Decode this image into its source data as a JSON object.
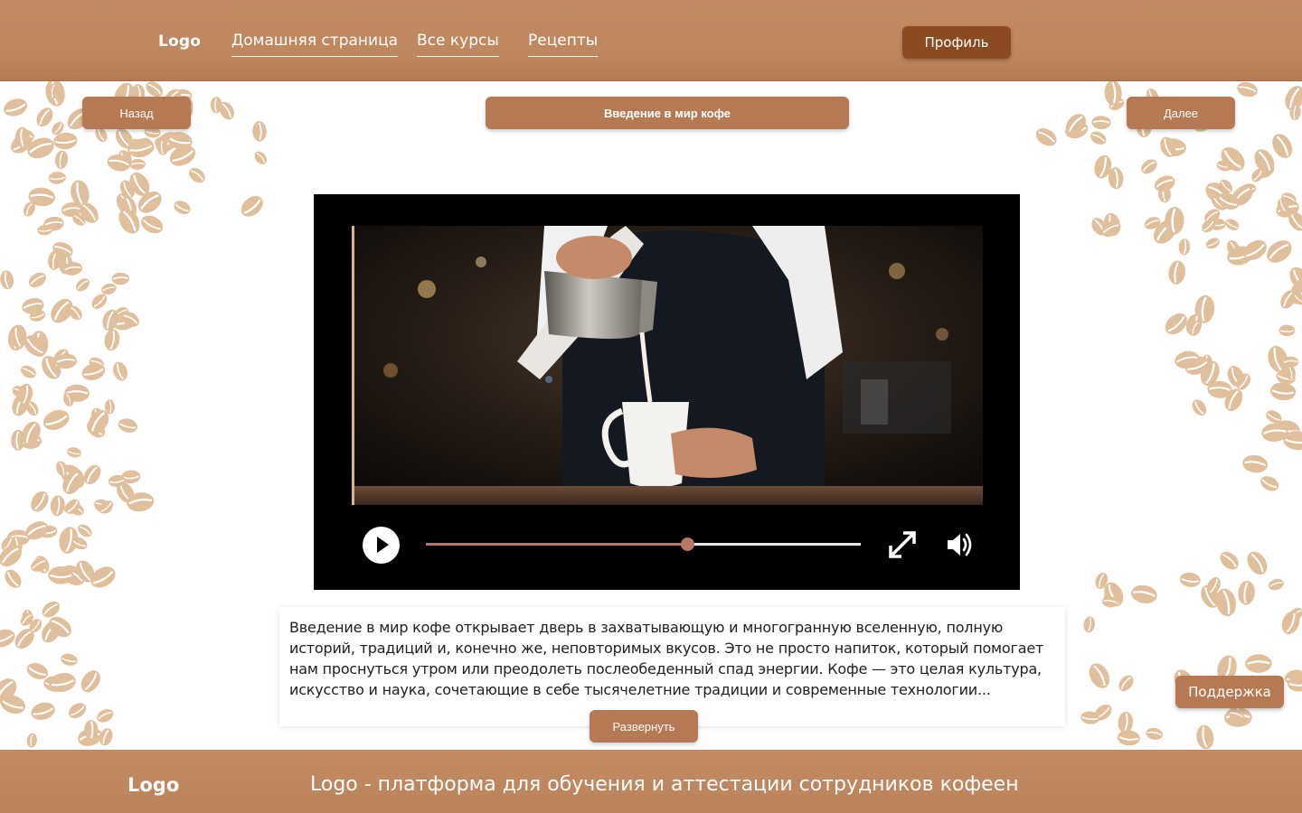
{
  "header": {
    "logo": "Logo",
    "nav": [
      {
        "label": "Домашняя страница"
      },
      {
        "label": "Все курсы"
      },
      {
        "label": "Рецепты"
      }
    ],
    "profile_label": "Профиль"
  },
  "lesson": {
    "back_label": "Назад",
    "title": "Введение в мир кофе",
    "next_label": "Далее"
  },
  "video": {
    "progress": 0.6,
    "play_icon": "play-icon",
    "fullscreen_icon": "fullscreen-icon",
    "volume_icon": "volume-icon"
  },
  "description": {
    "text": "Введение в мир кофе открывает дверь в захватывающую и многогранную вселенную, полную историй, традиций и, конечно же, неповторимых вкусов. Это не просто напиток, который помогает нам проснуться утром или преодолеть послеобеденный спад энергии. Кофе — это целая культура, искусство и наука, сочетающие в себе тысячелетние традиции и современные технологии...",
    "expand_label": "Развернуть"
  },
  "support_label": "Поддержка",
  "footer": {
    "logo": "Logo",
    "tagline": "Logo - платформа для обучения и аттестации сотрудников кофеен"
  },
  "colors": {
    "brand": "#bf875f",
    "button": "#b57a53",
    "profile": "#8b4a22",
    "bean": "#dfbf9c",
    "progress": "#b7766a"
  }
}
